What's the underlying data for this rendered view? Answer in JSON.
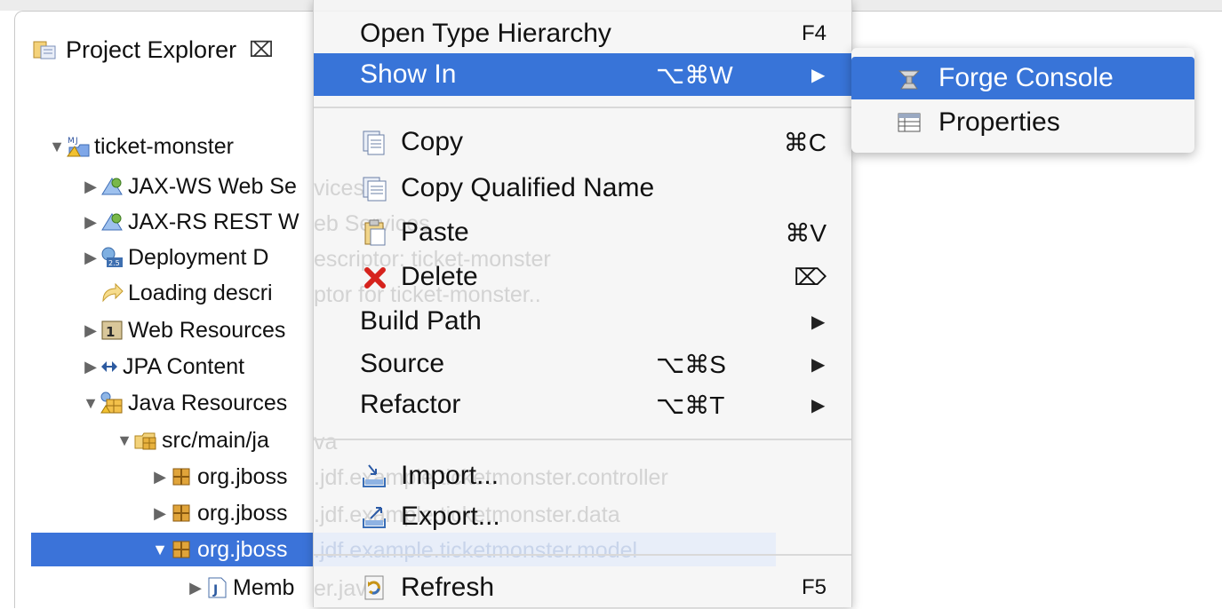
{
  "explorer": {
    "title": "Project Explorer",
    "close_glyph": "⌧",
    "tree": [
      {
        "label": "ticket-monster",
        "expanded": true,
        "icon": "maven-project-icon"
      },
      {
        "label": "JAX-WS Web Se",
        "expanded": false,
        "icon": "web-services-icon"
      },
      {
        "label": "JAX-RS REST W",
        "expanded": false,
        "icon": "web-services-icon"
      },
      {
        "label": "Deployment D",
        "expanded": false,
        "icon": "deployment-descriptor-icon"
      },
      {
        "label": "Loading descri",
        "icon": "loading-arrow-icon"
      },
      {
        "label": "Web Resources",
        "expanded": false,
        "icon": "web-resources-icon"
      },
      {
        "label": "JPA Content",
        "expanded": false,
        "icon": "jpa-icon"
      },
      {
        "label": "Java Resources",
        "expanded": true,
        "icon": "java-resources-icon"
      },
      {
        "label": "src/main/ja",
        "expanded": true,
        "icon": "source-folder-icon"
      },
      {
        "label": "org.jboss",
        "expanded": false,
        "icon": "package-icon"
      },
      {
        "label": "org.jboss",
        "expanded": false,
        "icon": "package-icon"
      },
      {
        "label": "org.jboss",
        "expanded": true,
        "selected": true,
        "icon": "package-icon"
      },
      {
        "label": "Memb",
        "expanded": false,
        "icon": "java-file-icon"
      }
    ],
    "ghost_text": {
      "jaxws": "vices",
      "jaxrs": "eb Services",
      "deploy": "escriptor: ticket-monster",
      "loading": "ptor for ticket-monster..",
      "src": "va",
      "pkg1": ".jdf.example.ticketmonster.controller",
      "pkg2": ".jdf.example.ticketmonster.data",
      "pkg3": ".jdf.example.ticketmonster.model",
      "member": "er.java"
    }
  },
  "context_menu": {
    "items": {
      "open_type_hierarchy": {
        "label": "Open Type Hierarchy",
        "shortcut": "F4"
      },
      "show_in": {
        "label": "Show In",
        "shortcut": "⌥⌘W",
        "submenu_arrow": "▶"
      },
      "copy": {
        "label": "Copy",
        "shortcut": "⌘C"
      },
      "copy_qualified_name": {
        "label": "Copy Qualified Name"
      },
      "paste": {
        "label": "Paste",
        "shortcut": "⌘V"
      },
      "delete": {
        "label": "Delete",
        "shortcut": "⌦"
      },
      "build_path": {
        "label": "Build Path",
        "submenu_arrow": "▶"
      },
      "source": {
        "label": "Source",
        "shortcut": "⌥⌘S",
        "submenu_arrow": "▶"
      },
      "refactor": {
        "label": "Refactor",
        "shortcut": "⌥⌘T",
        "submenu_arrow": "▶"
      },
      "import": {
        "label": "Import..."
      },
      "export": {
        "label": "Export..."
      },
      "refresh": {
        "label": "Refresh",
        "shortcut": "F5"
      }
    }
  },
  "submenu": {
    "items": {
      "forge_console": {
        "label": "Forge Console",
        "highlighted": true
      },
      "properties": {
        "label": "Properties"
      }
    }
  },
  "colors": {
    "selection": "#3874d8",
    "menu_bg": "#f5f5f5",
    "delete_red": "#d6231d"
  }
}
